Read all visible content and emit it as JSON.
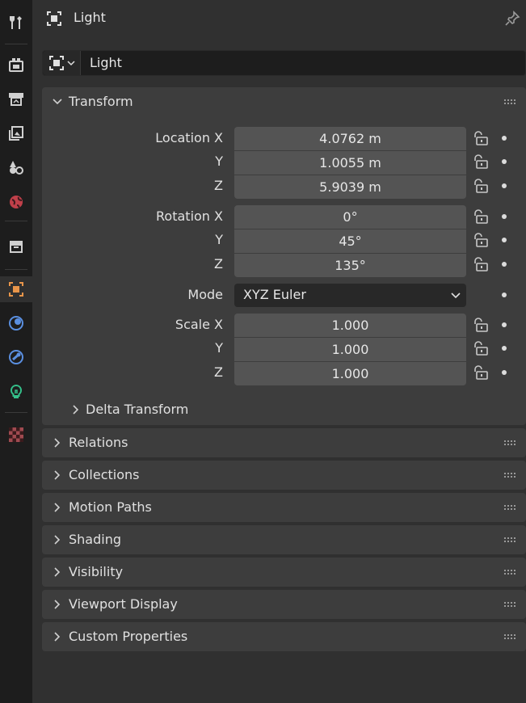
{
  "header": {
    "title": "Light"
  },
  "object_name": {
    "value": "Light"
  },
  "sidebar": {
    "items": [
      {
        "icon": "tool-icon"
      },
      {
        "icon": "render-icon"
      },
      {
        "icon": "output-icon"
      },
      {
        "icon": "view-layer-icon"
      },
      {
        "icon": "scene-icon"
      },
      {
        "icon": "world-icon"
      },
      {
        "icon": "collection-icon"
      },
      {
        "icon": "object-icon",
        "active": true
      },
      {
        "icon": "physics-icon"
      },
      {
        "icon": "constraints-icon"
      },
      {
        "icon": "light-data-icon"
      },
      {
        "icon": "texture-icon"
      }
    ]
  },
  "transform": {
    "title": "Transform",
    "location": {
      "label_x": "Location X",
      "label_y": "Y",
      "label_z": "Z",
      "x": "4.0762 m",
      "y": "1.0055 m",
      "z": "5.9039 m"
    },
    "rotation": {
      "label_x": "Rotation X",
      "label_y": "Y",
      "label_z": "Z",
      "x": "0°",
      "y": "45°",
      "z": "135°"
    },
    "mode": {
      "label": "Mode",
      "value": "XYZ Euler"
    },
    "scale": {
      "label_x": "Scale X",
      "label_y": "Y",
      "label_z": "Z",
      "x": "1.000",
      "y": "1.000",
      "z": "1.000"
    },
    "delta": {
      "title": "Delta Transform"
    }
  },
  "panels": [
    {
      "title": "Relations"
    },
    {
      "title": "Collections"
    },
    {
      "title": "Motion Paths"
    },
    {
      "title": "Shading"
    },
    {
      "title": "Visibility"
    },
    {
      "title": "Viewport Display"
    },
    {
      "title": "Custom Properties"
    }
  ],
  "colors": {
    "accent": "#e8954a",
    "background": "#303030",
    "field": "#545454"
  }
}
